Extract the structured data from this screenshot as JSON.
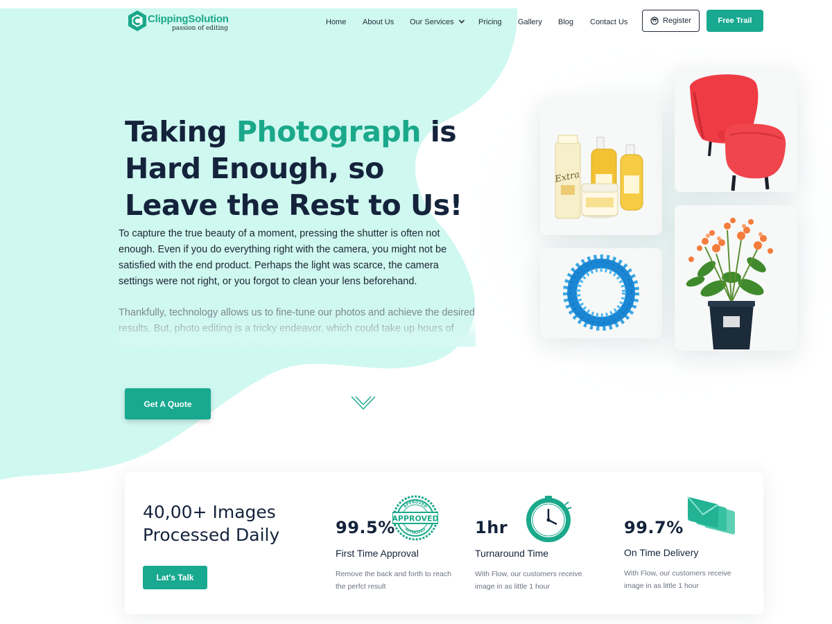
{
  "brand": {
    "name": "ClippingSolution",
    "tagline": "passion of editing",
    "accent_color": "#1aa88a",
    "dark_color": "#14233b"
  },
  "nav": {
    "items": [
      "Home",
      "About Us",
      "Our Services",
      "Pricing",
      "Gallery",
      "Blog",
      "Contact Us"
    ],
    "register_label": "Register",
    "register_icon": "user-icon",
    "free_trial_label": "Free Trail"
  },
  "hero": {
    "title_part1": "Taking ",
    "title_accent": "Photograph",
    "title_part2": " is Hard Enough, so Leave the Rest to Us!",
    "paragraph1": "To capture the true beauty of a moment, pressing the shutter is often not enough. Even if you do everything right with the camera, you might not be satisfied with the end product. Perhaps the light was scarce, the camera settings were not right, or you forgot to clean your lens beforehand.",
    "paragraph2": "Thankfully, technology allows us to fine-tune our photos and achieve the desired results. But,  photo editing is a tricky endeavor, which could take up hours of your time, with no guarantee that the results will match your expectations.",
    "cta_label": "Get A Quote",
    "scroll_icon": "chevron-down-icon"
  },
  "gallery": {
    "images": [
      "cosmetics-bottles-image",
      "red-armchair-image",
      "blue-ring-toy-image",
      "potted-flowers-image"
    ]
  },
  "stats": {
    "headline": "40,00+ Images Processed Daily",
    "cta_label": "Lat's Talk",
    "items": [
      {
        "value": "99.5%",
        "label": "First Time Approval",
        "description": "Remove the back and forth to reach the perfct result",
        "icon": "approved-stamp-icon",
        "stamp_text": "APPROVED",
        "stamp_ring_text": "APPROVED"
      },
      {
        "value": "1hr",
        "label": "Turnaround Time",
        "description": "With Flow, our customers receive image in as little 1 hour",
        "icon": "clock-icon"
      },
      {
        "value": "99.7%",
        "label": "On Time Delivery",
        "description": "With Flow, our customers receive image in as little 1 hour",
        "icon": "envelopes-icon"
      }
    ]
  }
}
